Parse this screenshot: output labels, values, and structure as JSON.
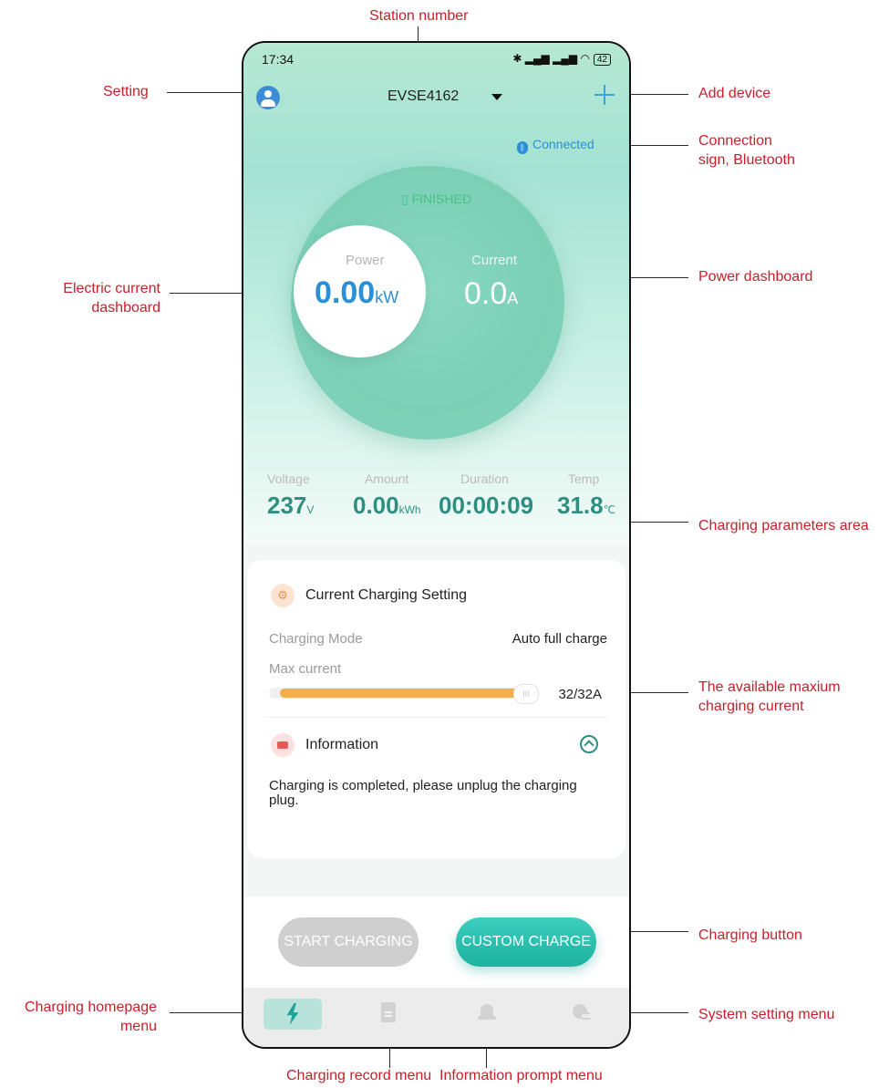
{
  "annotations": {
    "station_number": "Station number",
    "setting": "Setting",
    "add_device": "Add device",
    "connection_line1": "Connection",
    "connection_line2": "sign, Bluetooth",
    "electric_current_line1": "Electric current",
    "electric_current_line2": "dashboard",
    "power_dashboard": "Power dashboard",
    "charging_params": "Charging parameters area",
    "max_current_line1": "The available maxium",
    "max_current_line2": "charging current",
    "charging_button": "Charging button",
    "home_menu_line1": "Charging homepage",
    "home_menu_line2": "menu",
    "system_menu": "System setting menu",
    "record_menu": "Charging record menu",
    "info_menu": "Information prompt menu"
  },
  "status_bar": {
    "time": "17:34",
    "battery": "42"
  },
  "header": {
    "station": "EVSE4162",
    "connection": "Connected"
  },
  "dashboard": {
    "status": "FINISHED",
    "power_label": "Power",
    "power_value": "0.00",
    "power_unit": "kW",
    "current_label": "Current",
    "current_value": "0.0",
    "current_unit": "A"
  },
  "params": [
    {
      "label": "Voltage",
      "value": "237",
      "unit": "V"
    },
    {
      "label": "Amount",
      "value": "0.00",
      "unit": "kWh"
    },
    {
      "label": "Duration",
      "value": "00:00:09",
      "unit": ""
    },
    {
      "label": "Temp",
      "value": "31.8",
      "unit": "℃"
    }
  ],
  "settings": {
    "title": "Current Charging Setting",
    "mode_label": "Charging Mode",
    "mode_value": "Auto full charge",
    "max_label": "Max current",
    "max_value": "32/32A",
    "slider_fraction": 1.0
  },
  "info": {
    "title": "Information",
    "message": "Charging is completed, please unplug the charging plug."
  },
  "buttons": {
    "start": "START CHARGING",
    "custom": "CUSTOM CHARGE"
  },
  "colors": {
    "accent": "#1fa593",
    "brand_blue": "#2a8fd6",
    "slider": "#f4ad4b",
    "annotation": "#c8202b"
  },
  "icons": {
    "avatar": "user-icon",
    "add": "plus-icon",
    "bluetooth": "bluetooth-icon",
    "home": "bolt-icon",
    "records": "document-icon",
    "info": "bell-icon",
    "system": "gear-icon"
  }
}
